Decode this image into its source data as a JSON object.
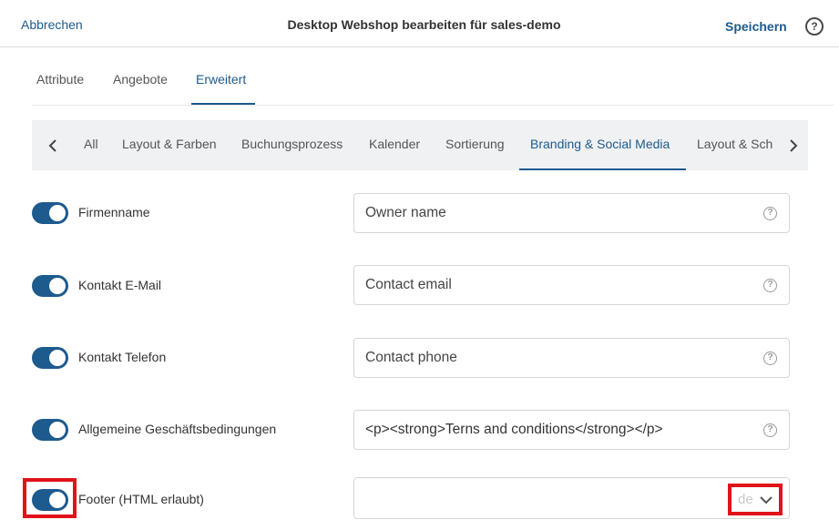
{
  "header": {
    "cancel_label": "Abbrechen",
    "title": "Desktop Webshop bearbeiten für sales-demo",
    "save_label": "Speichern",
    "help_icon": "?"
  },
  "main_tabs": [
    {
      "label": "Attribute",
      "active": false
    },
    {
      "label": "Angebote",
      "active": false
    },
    {
      "label": "Erweitert",
      "active": true
    }
  ],
  "sub_tabs": [
    {
      "label": "All",
      "active": false
    },
    {
      "label": "Layout & Farben",
      "active": false
    },
    {
      "label": "Buchungsprozess",
      "active": false
    },
    {
      "label": "Kalender",
      "active": false
    },
    {
      "label": "Sortierung",
      "active": false
    },
    {
      "label": "Branding & Social Media",
      "active": true
    },
    {
      "label": "Layout & Sch",
      "active": false
    }
  ],
  "rows": [
    {
      "label": "Firmenname",
      "enabled": true,
      "value": "",
      "placeholder": "Owner name"
    },
    {
      "label": "Kontakt E-Mail",
      "enabled": true,
      "value": "",
      "placeholder": "Contact email"
    },
    {
      "label": "Kontakt Telefon",
      "enabled": true,
      "value": "",
      "placeholder": "Contact phone"
    },
    {
      "label": "Allgemeine Geschäftsbedingungen",
      "enabled": true,
      "value": "<p><strong>Terns and conditions</strong></p>",
      "placeholder": ""
    },
    {
      "label": "Footer (HTML erlaubt)",
      "enabled": true,
      "value": "",
      "placeholder": "",
      "language": "de"
    }
  ],
  "colors": {
    "accent": "#1d5a8e",
    "highlight": "#e1131a",
    "subtab_bg": "#f0f1f3"
  },
  "icons": {
    "field_help": "question-circle-icon",
    "prev": "chevron-left-icon",
    "next": "chevron-right-icon",
    "lang_dropdown": "chevron-down-icon"
  }
}
